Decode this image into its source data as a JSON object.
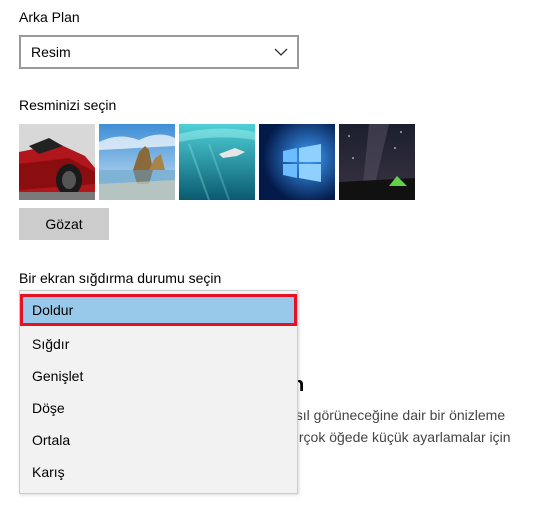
{
  "background": {
    "label": "Arka Plan",
    "select_value": "Resim"
  },
  "picture": {
    "label": "Resminizi seçin",
    "thumbnails": [
      "red-car",
      "rocks-beach",
      "underwater-swimmer",
      "windows-logo",
      "night-sky-tent"
    ],
    "browse_label": "Gözat"
  },
  "fit": {
    "label": "Bir ekran sığdırma durumu seçin",
    "options": [
      "Doldur",
      "Sığdır",
      "Genişlet",
      "Döşe",
      "Ortala",
      "Karış"
    ],
    "selected_index": 0
  },
  "behind": {
    "heading": "n",
    "line1": "asıl görüneceğine dair bir önizleme",
    "line2": "birçok öğede küçük ayarlamalar için"
  },
  "colors": {
    "selected_bg": "#99c9ea",
    "focus_border": "#e81123",
    "button_bg": "#cccccc"
  }
}
